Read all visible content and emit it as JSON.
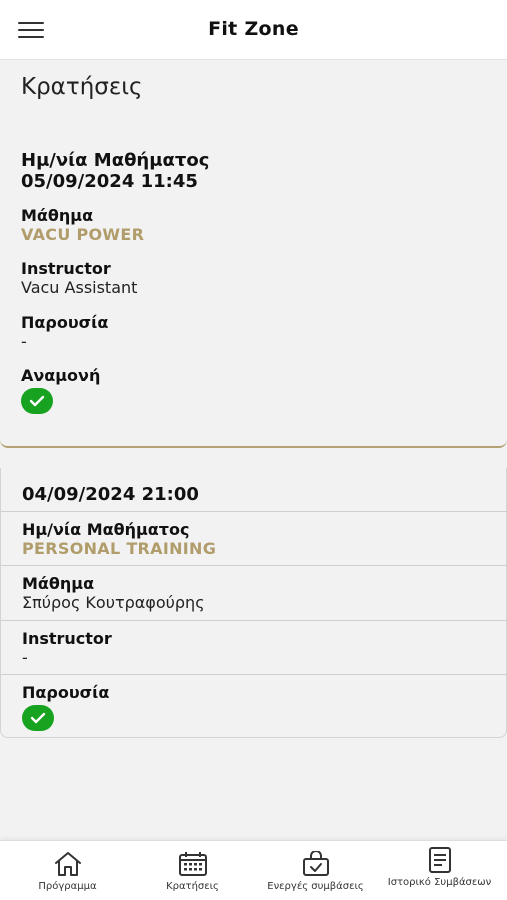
{
  "header": {
    "title": "Fit Zone",
    "menu_icon": "hamburger-icon"
  },
  "page": {
    "title": "Κρατήσεις"
  },
  "booking1": {
    "date_label": "Ημ/νία Μαθήματος",
    "date_value": "05/09/2024 11:45",
    "lesson_label": "Μάθημα",
    "lesson_value": "VACU POWER",
    "instructor_label": "Instructor",
    "instructor_value": "Vacu Assistant",
    "attendance_label": "Παρουσία",
    "attendance_value": "-",
    "waiting_label": "Αναμονή",
    "waiting_status": "check-icon"
  },
  "booking2": {
    "header_value": "04/09/2024 21:00",
    "date_label": "Ημ/νία Μαθήματος",
    "date_value": "PERSONAL TRAINING",
    "lesson_label": "Μάθημα",
    "lesson_value": "Σπύρος Κουτραφούρης",
    "instructor_label": "Instructor",
    "instructor_value": "-",
    "attendance_label": "Παρουσία",
    "attendance_status": "check-icon"
  },
  "tabs": [
    {
      "label": "Πρόγραμμα",
      "icon": "home-icon"
    },
    {
      "label": "Κρατήσεις",
      "icon": "calendar-icon"
    },
    {
      "label": "Ενεργές συμβάσεις",
      "icon": "bag-check-icon"
    },
    {
      "label": "Ιστορικό Συμβάσεων",
      "icon": "document-icon"
    }
  ],
  "colors": {
    "accent": "#b19d6b",
    "check": "#17a31f",
    "background": "#f2f2f2"
  }
}
